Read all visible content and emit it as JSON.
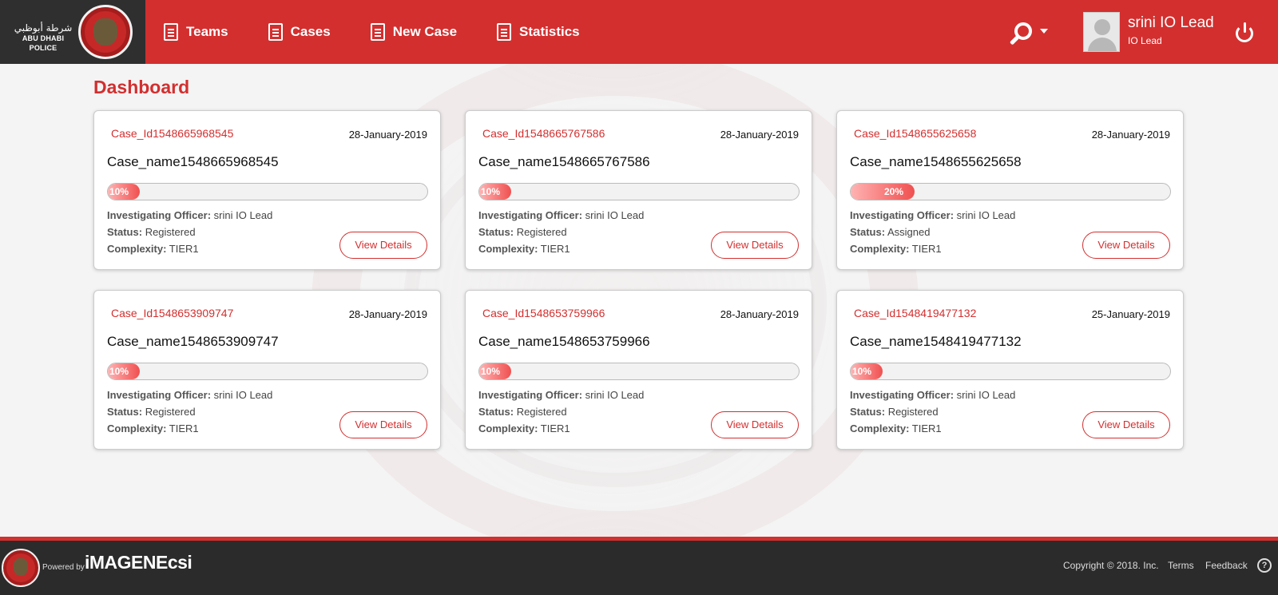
{
  "brand": {
    "arabic_name": "شرطة أبوظبي",
    "english_name": "ABU DHABI POLICE"
  },
  "nav": {
    "items": [
      {
        "label": "Teams",
        "icon": "document-list-icon"
      },
      {
        "label": "Cases",
        "icon": "document-list-icon"
      },
      {
        "label": "New Case",
        "icon": "document-icon"
      },
      {
        "label": "Statistics",
        "icon": "document-icon"
      }
    ]
  },
  "user": {
    "name": "srini IO Lead",
    "role": "IO Lead"
  },
  "page": {
    "title": "Dashboard"
  },
  "labels": {
    "officer": "Investigating Officer:",
    "status": "Status:",
    "complexity": "Complexity:",
    "view_details": "View Details"
  },
  "cases": [
    {
      "id": "Case_Id1548665968545",
      "date": "28-January-2019",
      "name": "Case_name1548665968545",
      "progress": 10,
      "progress_label": "10%",
      "officer": "srini IO Lead",
      "status": "Registered",
      "complexity": "TIER1"
    },
    {
      "id": "Case_Id1548665767586",
      "date": "28-January-2019",
      "name": "Case_name1548665767586",
      "progress": 10,
      "progress_label": "10%",
      "officer": "srini IO Lead",
      "status": "Registered",
      "complexity": "TIER1"
    },
    {
      "id": "Case_Id1548655625658",
      "date": "28-January-2019",
      "name": "Case_name1548655625658",
      "progress": 20,
      "progress_label": "20%",
      "officer": "srini IO Lead",
      "status": "Assigned",
      "complexity": "TIER1"
    },
    {
      "id": "Case_Id1548653909747",
      "date": "28-January-2019",
      "name": "Case_name1548653909747",
      "progress": 10,
      "progress_label": "10%",
      "officer": "srini IO Lead",
      "status": "Registered",
      "complexity": "TIER1"
    },
    {
      "id": "Case_Id1548653759966",
      "date": "28-January-2019",
      "name": "Case_name1548653759966",
      "progress": 10,
      "progress_label": "10%",
      "officer": "srini IO Lead",
      "status": "Registered",
      "complexity": "TIER1"
    },
    {
      "id": "Case_Id1548419477132",
      "date": "25-January-2019",
      "name": "Case_name1548419477132",
      "progress": 10,
      "progress_label": "10%",
      "officer": "srini IO Lead",
      "status": "Registered",
      "complexity": "TIER1"
    }
  ],
  "footer": {
    "powered_by": "Powered by",
    "brand": "iMAGENEcsi",
    "copyright": "Copyright © 2018. Inc.",
    "terms": "Terms",
    "feedback": "Feedback",
    "help": "?"
  },
  "colors": {
    "primary": "#d32f2f",
    "dark": "#2b2b2b",
    "progress_start": "#ffb3b3",
    "progress_end": "#f05050"
  }
}
